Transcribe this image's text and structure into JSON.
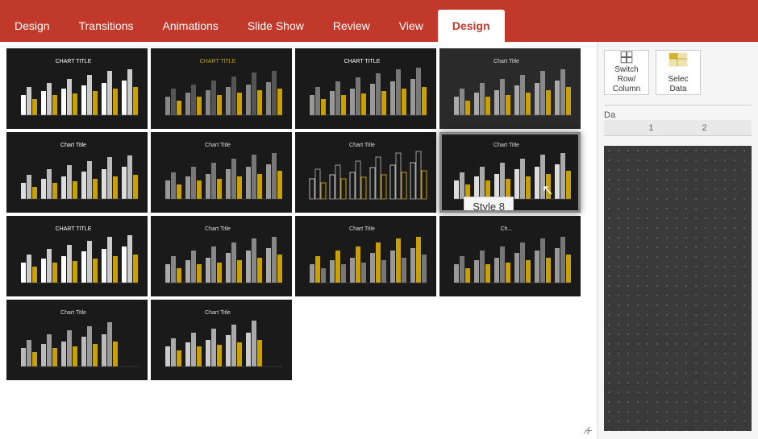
{
  "ribbon": {
    "tabs": [
      {
        "id": "design-left",
        "label": "Design",
        "active": false
      },
      {
        "id": "transitions",
        "label": "Transitions",
        "active": false
      },
      {
        "id": "animations",
        "label": "Animations",
        "active": false
      },
      {
        "id": "slideshow",
        "label": "Slide Show",
        "active": false
      },
      {
        "id": "review",
        "label": "Review",
        "active": false
      },
      {
        "id": "view",
        "label": "View",
        "active": false
      },
      {
        "id": "design-right",
        "label": "Design",
        "active": true
      }
    ]
  },
  "right_panel": {
    "switch_row_column_label": "Switch Row/\nColumn",
    "select_data_label": "Selec",
    "data_label": "Data",
    "section_label": "Da"
  },
  "tooltip": {
    "text": "Style 8"
  },
  "styles": {
    "count": 14,
    "selected_index": 7
  },
  "ruler": {
    "markers": [
      "1",
      "2"
    ]
  }
}
